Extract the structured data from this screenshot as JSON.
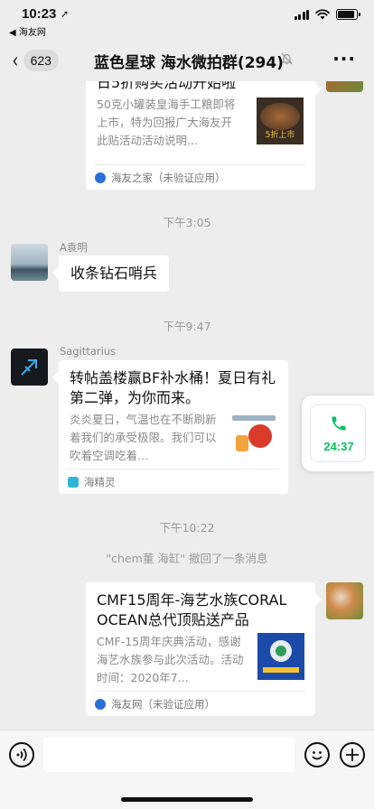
{
  "status_bar": {
    "time": "10:23",
    "location_glyph": "➚",
    "back_app": "◀ 海友网"
  },
  "nav": {
    "back_count": "623",
    "title": "蓝色星球 海水微拍群(294)",
    "more": "···"
  },
  "messages": {
    "card1": {
      "title": "日5折购买活动开始啦",
      "desc": "50克小罐装皇海手工粮即将上市，特为回报广大海友开此贴活动活动说明...",
      "thumb_text": "5折上市",
      "source": "海友之家（未验证应用）"
    },
    "time1": "下午3:05",
    "msg1": {
      "sender": "A袁明",
      "text": "收条钻石哨兵"
    },
    "time2": "下午9:47",
    "card2": {
      "sender": "Sagittarius",
      "title": "转帖盖楼赢BF补水桶！夏日有礼第二弹，为你而来。",
      "desc": "炎炎夏日，气温也在不断刷新着我们的承受极限。我们可以吹着空调吃着...",
      "source": "海精灵"
    },
    "time3": "下午10:22",
    "recall": "\"chem董 海缸\" 撤回了一条消息",
    "card3": {
      "title": "CMF15周年-海艺水族CORAL OCEAN总代顶贴送产品",
      "desc": "CMF-15周年庆典活动，感谢海艺水族参与此次活动。活动时间：2020年7...",
      "source": "海友网（未验证应用）"
    }
  },
  "float_call": {
    "duration": "24:37"
  },
  "colors": {
    "accent_green": "#07c160",
    "background": "#ededed"
  }
}
